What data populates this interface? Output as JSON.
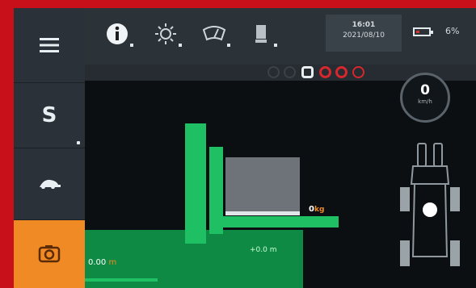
{
  "sidebar": {
    "speed_mode_label": "S"
  },
  "topbar": {
    "icons": [
      "info-icon",
      "work-light-icon",
      "wiper-icon",
      "seat-icon"
    ],
    "clock_time": "16:01",
    "clock_date": "2021/08/10",
    "battery_percent": "6%"
  },
  "speed": {
    "value": "0",
    "unit": "km/h"
  },
  "fork": {
    "weight_value": "0",
    "weight_unit": "kg",
    "height_label": "+0.0 m"
  },
  "travel": {
    "distance_value": "0.00",
    "distance_unit": "m"
  },
  "colors": {
    "accent_orange": "#f08a24",
    "fork_green": "#1fbf63",
    "ground_green": "#0e8a44",
    "frame_red": "#c8101a"
  }
}
